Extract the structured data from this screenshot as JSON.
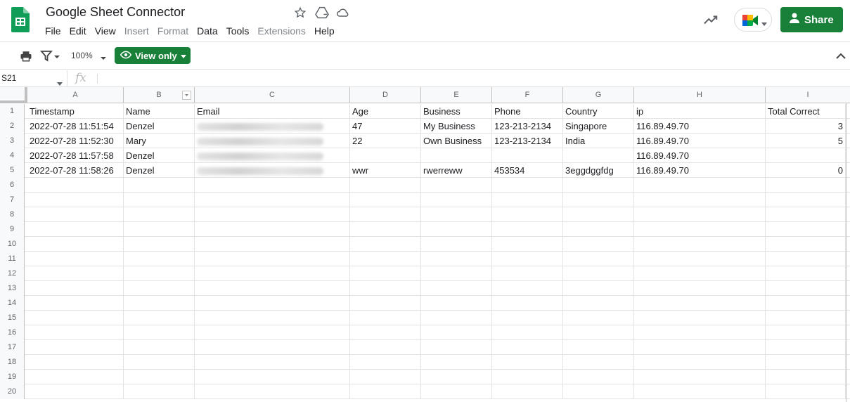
{
  "app": {
    "title": "Google Sheet Connector",
    "share_label": "Share",
    "menu": [
      {
        "label": "File",
        "disabled": false
      },
      {
        "label": "Edit",
        "disabled": false
      },
      {
        "label": "View",
        "disabled": false
      },
      {
        "label": "Insert",
        "disabled": true
      },
      {
        "label": "Format",
        "disabled": true
      },
      {
        "label": "Data",
        "disabled": false
      },
      {
        "label": "Tools",
        "disabled": false
      },
      {
        "label": "Extensions",
        "disabled": true
      },
      {
        "label": "Help",
        "disabled": false
      }
    ],
    "accent_color": "#188038"
  },
  "toolbar": {
    "zoom": "100%",
    "view_only_label": "View only"
  },
  "formula_bar": {
    "cell_ref": "S21",
    "fx": "fx"
  },
  "sheet": {
    "columns": [
      "A",
      "B",
      "C",
      "D",
      "E",
      "F",
      "G",
      "H",
      "I"
    ],
    "row_numbers": [
      "1",
      "2",
      "3",
      "4",
      "5",
      "6",
      "7",
      "8",
      "9",
      "10",
      "11",
      "12",
      "13",
      "14",
      "15",
      "16",
      "17",
      "18",
      "19",
      "20"
    ],
    "rows": [
      [
        "Timestamp",
        "Name",
        "Email",
        "Age",
        "Business",
        "Phone",
        "Country",
        "ip",
        "Total Correct"
      ],
      [
        "2022-07-28 11:51:54",
        "Denzel",
        "",
        "47",
        "My Business",
        "123-213-2134",
        "Singapore",
        "116.89.49.70",
        "3"
      ],
      [
        "2022-07-28 11:52:30",
        "Mary",
        "",
        "22",
        "Own Business",
        "123-213-2134",
        "India",
        "116.89.49.70",
        "5"
      ],
      [
        "2022-07-28 11:57:58",
        "Denzel",
        "",
        "",
        "",
        "",
        "",
        "116.89.49.70",
        ""
      ],
      [
        "2022-07-28 11:58:26",
        "Denzel",
        "",
        "wwr",
        "rwerreww",
        "453534",
        "3eggdggfdg",
        "116.89.49.70",
        "0"
      ]
    ]
  }
}
